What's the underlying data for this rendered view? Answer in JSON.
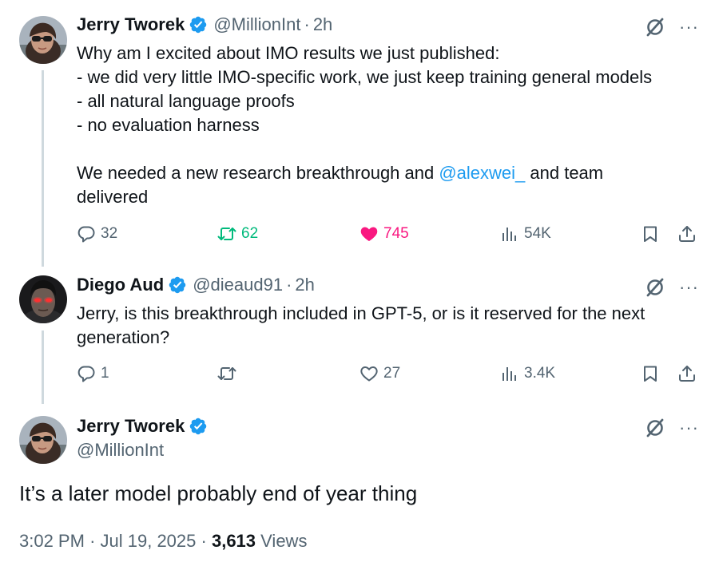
{
  "tweets": [
    {
      "author_name": "Jerry Tworek",
      "handle": "@MillionInt",
      "time": "2h",
      "lines": [
        "Why am I excited about IMO results we just published:",
        "- we did very little IMO-specific work, we just keep training general models",
        "- all natural language proofs",
        "- no evaluation harness",
        "",
        "We needed a new research breakthrough and ",
        "delivered"
      ],
      "mention": "@alexwei_",
      "mention_suffix": " and team",
      "replies": "32",
      "reposts": "62",
      "likes": "745",
      "views": "54K"
    },
    {
      "author_name": "Diego Aud",
      "handle": "@dieaud91",
      "time": "2h",
      "lines": [
        "Jerry, is this breakthrough included in GPT-5, or is it reserved for the next",
        "generation?"
      ],
      "replies": "1",
      "reposts": "",
      "likes": "27",
      "views": "3.4K"
    }
  ],
  "main_tweet": {
    "author_name": "Jerry Tworek",
    "handle": "@MillionInt",
    "text": "It’s a later model probably end of year thing",
    "time": "3:02 PM",
    "date": "Jul 19, 2025",
    "views_count": "3,613",
    "views_label": "Views"
  },
  "sep": "·",
  "more_glyph": "···",
  "colors": {
    "accent": "#1d9bf0",
    "repost": "#00ba7c",
    "like": "#f91880",
    "secondary": "#536471"
  },
  "icons": [
    "verified-badge-icon",
    "grok-icon",
    "more-icon",
    "reply-icon",
    "repost-icon",
    "like-icon",
    "views-icon",
    "bookmark-icon",
    "share-icon"
  ]
}
